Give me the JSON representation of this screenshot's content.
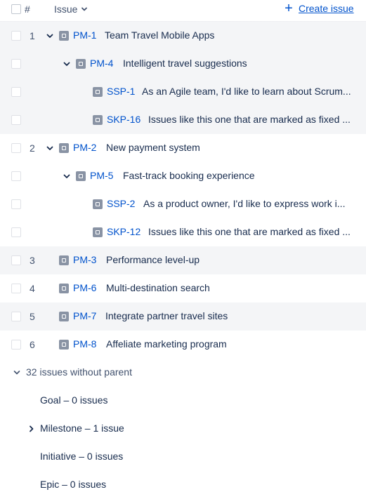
{
  "header": {
    "num_label": "#",
    "issue_label": "Issue",
    "create_label": "Create issue"
  },
  "rows": [
    {
      "num": "1",
      "key": "PM-1",
      "summary": "Team Travel Mobile Apps"
    },
    {
      "num": "",
      "key": "PM-4",
      "summary": "Intelligent travel suggestions"
    },
    {
      "num": "",
      "key": "SSP-1",
      "summary": "As an Agile team, I'd like to learn about Scrum..."
    },
    {
      "num": "",
      "key": "SKP-16",
      "summary": "Issues like this one that are marked as fixed ..."
    },
    {
      "num": "2",
      "key": "PM-2",
      "summary": "New payment system"
    },
    {
      "num": "",
      "key": "PM-5",
      "summary": "Fast-track booking experience"
    },
    {
      "num": "",
      "key": "SSP-2",
      "summary": "As a product owner, I'd like to express work i..."
    },
    {
      "num": "",
      "key": "SKP-12",
      "summary": "Issues like this one that are marked as fixed ..."
    },
    {
      "num": "3",
      "key": "PM-3",
      "summary": "Performance level-up"
    },
    {
      "num": "4",
      "key": "PM-6",
      "summary": "Multi-destination search"
    },
    {
      "num": "5",
      "key": "PM-7",
      "summary": "Integrate partner travel sites"
    },
    {
      "num": "6",
      "key": "PM-8",
      "summary": "Affeliate marketing program"
    }
  ],
  "without_parent": {
    "label": "32 issues without parent",
    "groups": [
      {
        "label": "Goal – 0 issues"
      },
      {
        "label": "Milestone – 1 issue"
      },
      {
        "label": "Initiative – 0 issues"
      },
      {
        "label": "Epic – 0 issues"
      }
    ]
  }
}
